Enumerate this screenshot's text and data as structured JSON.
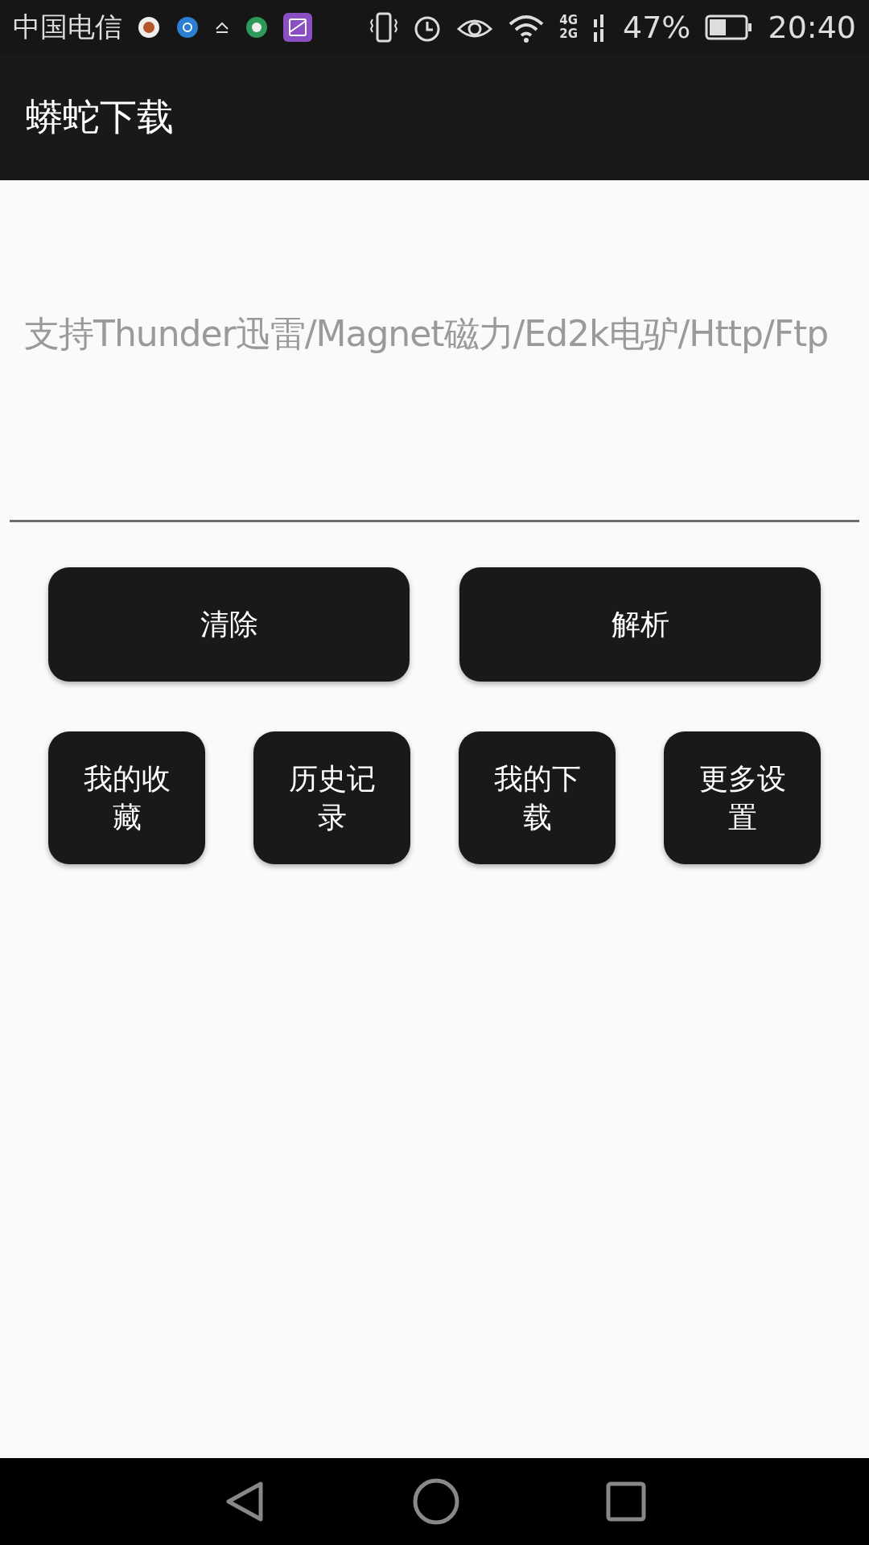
{
  "status_bar": {
    "carrier": "中国电信",
    "network_top": "4G",
    "network_bottom": "2G",
    "battery": "47%",
    "time": "20:40"
  },
  "app_bar": {
    "title": "蟒蛇下载"
  },
  "link_field": {
    "placeholder": "支持Thunder迅雷/Magnet磁力/Ed2k电驴/Http/Ftp"
  },
  "main_buttons": [
    "清除",
    "解析"
  ],
  "menu_buttons": [
    "我的收藏",
    "历史记录",
    "我的下载",
    "更多设置"
  ]
}
